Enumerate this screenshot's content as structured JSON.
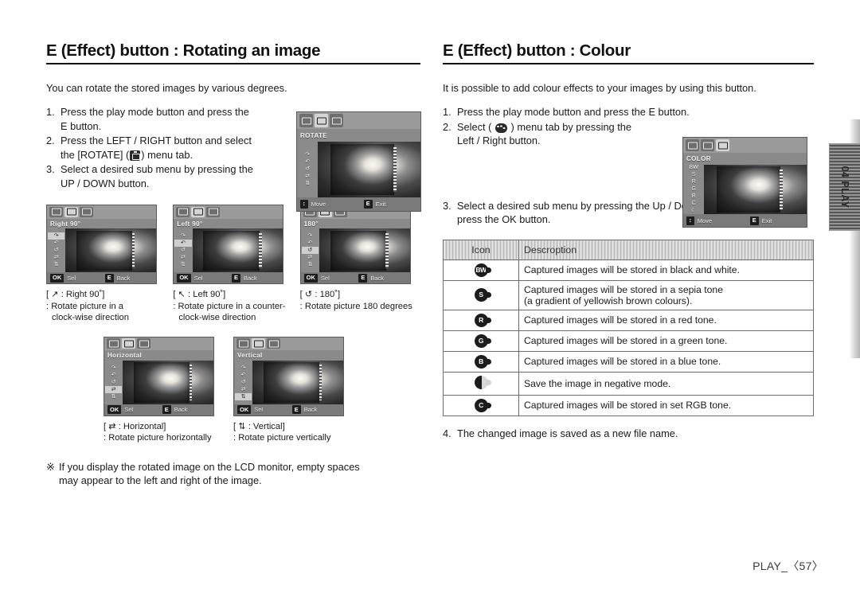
{
  "left": {
    "heading": "E (Effect) button : Rotating an image",
    "intro": "You can rotate the stored images by various degrees.",
    "steps": [
      {
        "num": "1.",
        "line1": "Press the play mode button and press the",
        "line2": "E button."
      },
      {
        "num": "2.",
        "line1": "Press the LEFT / RIGHT button and select",
        "pre2": "the [ROTATE] (",
        "post2": ") menu tab.",
        "icon": "rotate-menu-icon"
      },
      {
        "num": "3.",
        "line1": "Select a desired sub menu by pressing the",
        "line2": "UP / DOWN button."
      }
    ],
    "screen": {
      "title": "ROTATE",
      "move_key": "↕",
      "move_label": "Move",
      "exit_key": "E",
      "exit_label": "Exit",
      "side_items": [
        "↷",
        "↶",
        "↺",
        "⇄",
        "⇅"
      ]
    },
    "options_row1": [
      {
        "screen_title": "Right 90°",
        "ok_key": "OK",
        "ok_label": "Sel",
        "back_key": "E",
        "back_label": "Back",
        "cap_title": "[ ↗ : Right 90˚]",
        "cap_desc": ": Rotate picture in a",
        "cap_desc2": "clock-wise direction",
        "active_index": 0
      },
      {
        "screen_title": "Left 90°",
        "ok_key": "OK",
        "ok_label": "Sel",
        "back_key": "E",
        "back_label": "Back",
        "cap_title": "[ ↖ : Left 90˚]",
        "cap_desc": ": Rotate picture in a counter-",
        "cap_desc2": "clock-wise direction",
        "active_index": 1
      },
      {
        "screen_title": "180°",
        "ok_key": "OK",
        "ok_label": "Sel",
        "back_key": "E",
        "back_label": "Back",
        "cap_title": "[ ↺ :  180˚]",
        "cap_desc": ": Rotate picture 180 degrees",
        "cap_desc2": "",
        "active_index": 2
      }
    ],
    "options_row2": [
      {
        "screen_title": "Horizontal",
        "ok_key": "OK",
        "ok_label": "Sel",
        "back_key": "E",
        "back_label": "Back",
        "cap_title": "[ ⇄ :  Horizontal]",
        "cap_desc": ": Rotate picture horizontally",
        "cap_desc2": "",
        "active_index": 3
      },
      {
        "screen_title": "Vertical",
        "ok_key": "OK",
        "ok_label": "Sel",
        "back_key": "E",
        "back_label": "Back",
        "cap_title": "[ ⇅ :  Vertical]",
        "cap_desc": ": Rotate picture vertically",
        "cap_desc2": "",
        "active_index": 4
      }
    ],
    "note": {
      "mark": "※",
      "line1": "If you display the rotated image on the LCD monitor, empty spaces",
      "line2": "may appear to the left and right of the image."
    }
  },
  "right": {
    "heading": "E (Effect) button : Colour",
    "intro": "It is possible to add colour effects to your images by using this button.",
    "steps": [
      {
        "num": "1.",
        "line1": "Press the play mode button and press the E button."
      },
      {
        "num": "2.",
        "pre2": "Select ( ",
        "post2": " ) menu tab by pressing the",
        "line2": "Left / Right button.",
        "icon": "colour-menu-icon"
      },
      {
        "num": "3.",
        "line1": "Select a desired sub menu by pressing the Up / Down button and",
        "line2": "press the OK button."
      }
    ],
    "screen": {
      "title": "COLOR",
      "move_key": "↕",
      "move_label": "Move",
      "exit_key": "E",
      "exit_label": "Exit",
      "side_items": [
        "BW",
        "S",
        "R",
        "G",
        "B",
        "C",
        "☾"
      ]
    },
    "table": {
      "headers": [
        "Icon",
        "Descroption"
      ],
      "rows": [
        {
          "icon": "BW",
          "style": "solid",
          "desc": "Captured images will be stored in black and white."
        },
        {
          "icon": "S",
          "style": "solid",
          "desc": "Captured images will be stored in a sepia tone\n(a gradient of yellowish brown colours)."
        },
        {
          "icon": "R",
          "style": "solid",
          "desc": "Captured images will be stored in a red tone."
        },
        {
          "icon": "G",
          "style": "solid",
          "desc": "Captured images will be stored in a green tone."
        },
        {
          "icon": "B",
          "style": "solid",
          "desc": "Captured images will be stored in a blue tone."
        },
        {
          "icon": "",
          "style": "half",
          "desc": "Save the image in negative mode."
        },
        {
          "icon": "C",
          "style": "solid",
          "desc": "Captured images will be stored in set RGB tone."
        }
      ]
    },
    "step4": {
      "num": "4.",
      "text": "The changed image is saved as a new file name."
    }
  },
  "side_tab": {
    "label": "04 PLAY"
  },
  "footer": {
    "text": "PLAY_〈57〉"
  }
}
